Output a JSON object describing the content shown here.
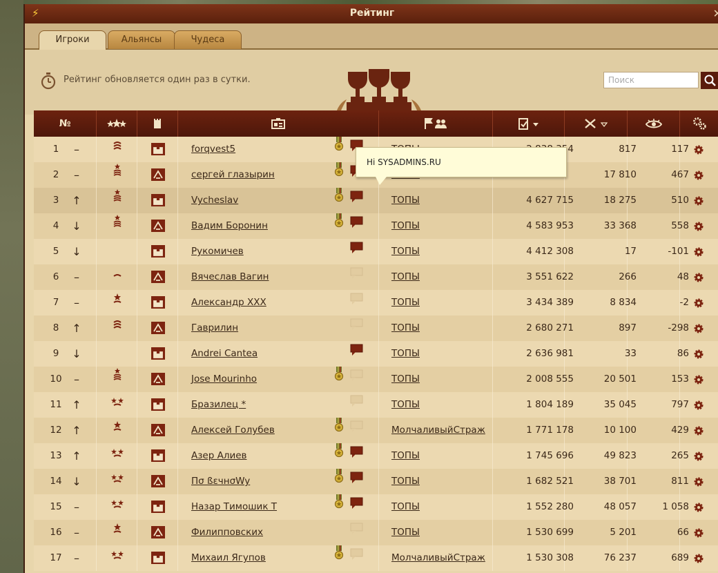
{
  "window": {
    "title": "Рейтинг"
  },
  "tabs": [
    {
      "label": "Игроки",
      "active": true
    },
    {
      "label": "Альянсы",
      "active": false
    },
    {
      "label": "Чудеса",
      "active": false
    }
  ],
  "info": {
    "text": "Рейтинг обновляется один раз в сутки."
  },
  "search": {
    "placeholder": "Поиск"
  },
  "columns": {
    "rank": "№"
  },
  "tooltip": {
    "text": "Hi SYSADMINS.RU"
  },
  "colors": {
    "header": "#5a1c0c",
    "accent": "#7d2410",
    "row_odd": "#ecd9b1",
    "row_even": "#e4cfa3"
  },
  "rows": [
    {
      "rank": "1",
      "trend": "–",
      "name": "forqvest5",
      "alliance": "ТОПЫ",
      "points": "2 838 354",
      "battle": "817",
      "spy": "117",
      "medal": true,
      "msg": true,
      "badge": "wave"
    },
    {
      "rank": "2",
      "trend": "–",
      "name": "сергей глазырин",
      "alliance": "ТОПЫ",
      "points": "",
      "battle": "17 810",
      "spy": "467",
      "medal": true,
      "msg": true,
      "badge": "stack"
    },
    {
      "rank": "3",
      "trend": "↑",
      "name": "Vycheslav",
      "alliance": "ТОПЫ",
      "points": "4 627 715",
      "battle": "18 275",
      "spy": "510",
      "medal": true,
      "msg": true,
      "badge": "stack"
    },
    {
      "rank": "4",
      "trend": "↓",
      "name": "Вадим Боронин",
      "alliance": "ТОПЫ",
      "points": "4 583 953",
      "battle": "33 368",
      "spy": "558",
      "medal": true,
      "msg": true,
      "badge": "stack"
    },
    {
      "rank": "5",
      "trend": "↓",
      "name": "Рукомичев",
      "alliance": "ТОПЫ",
      "points": "4 412 308",
      "battle": "17",
      "spy": "-101",
      "medal": false,
      "msg": true,
      "badge": ""
    },
    {
      "rank": "6",
      "trend": "–",
      "name": "Вячеслав Вагин",
      "alliance": "ТОПЫ",
      "points": "3 551 622",
      "battle": "266",
      "spy": "48",
      "medal": false,
      "msg": false,
      "badge": "small"
    },
    {
      "rank": "7",
      "trend": "–",
      "name": "Александр XXX",
      "alliance": "ТОПЫ",
      "points": "3 434 389",
      "battle": "8 834",
      "spy": "-2",
      "medal": false,
      "msg": false,
      "badge": "star"
    },
    {
      "rank": "8",
      "trend": "↑",
      "name": "Гаврилин",
      "alliance": "ТОПЫ",
      "points": "2 680 271",
      "battle": "897",
      "spy": "-298",
      "medal": false,
      "msg": false,
      "badge": "wave"
    },
    {
      "rank": "9",
      "trend": "↓",
      "name": "Andrei Cantea",
      "alliance": "ТОПЫ",
      "points": "2 636 981",
      "battle": "33",
      "spy": "86",
      "medal": false,
      "msg": true,
      "badge": ""
    },
    {
      "rank": "10",
      "trend": "–",
      "name": "Jose Mourinho",
      "alliance": "ТОПЫ",
      "points": "2 008 555",
      "battle": "20 501",
      "spy": "153",
      "medal": true,
      "msg": false,
      "badge": "stack"
    },
    {
      "rank": "11",
      "trend": "↑",
      "name": "Бразилец *",
      "alliance": "ТОПЫ",
      "points": "1 804 189",
      "battle": "35 045",
      "spy": "797",
      "medal": false,
      "msg": false,
      "badge": "stars"
    },
    {
      "rank": "12",
      "trend": "↑",
      "name": "Алексей Голубев",
      "alliance": "МолчаливыйСтраж",
      "points": "1 771 178",
      "battle": "10 100",
      "spy": "429",
      "medal": true,
      "msg": false,
      "badge": "star"
    },
    {
      "rank": "13",
      "trend": "↑",
      "name": "Азер Алиев",
      "alliance": "ТОПЫ",
      "points": "1 745 696",
      "battle": "49 823",
      "spy": "265",
      "medal": true,
      "msg": true,
      "badge": "stars"
    },
    {
      "rank": "14",
      "trend": "↓",
      "name": "Пσ ßεчнσWy",
      "alliance": "ТОПЫ",
      "points": "1 682 521",
      "battle": "38 701",
      "spy": "811",
      "medal": true,
      "msg": true,
      "badge": "stars"
    },
    {
      "rank": "15",
      "trend": "–",
      "name": "Назар Тимошик Т",
      "alliance": "ТОПЫ",
      "points": "1 552 280",
      "battle": "48 057",
      "spy": "1 058",
      "medal": true,
      "msg": true,
      "badge": "stars"
    },
    {
      "rank": "16",
      "trend": "–",
      "name": "Филипповских",
      "alliance": "ТОПЫ",
      "points": "1 530 699",
      "battle": "5 201",
      "spy": "66",
      "medal": false,
      "msg": false,
      "badge": "star"
    },
    {
      "rank": "17",
      "trend": "–",
      "name": "Михаил Ягупов",
      "alliance": "МолчаливыйСтраж",
      "points": "1 530 308",
      "battle": "76 237",
      "spy": "689",
      "medal": true,
      "msg": false,
      "badge": "stars"
    }
  ]
}
